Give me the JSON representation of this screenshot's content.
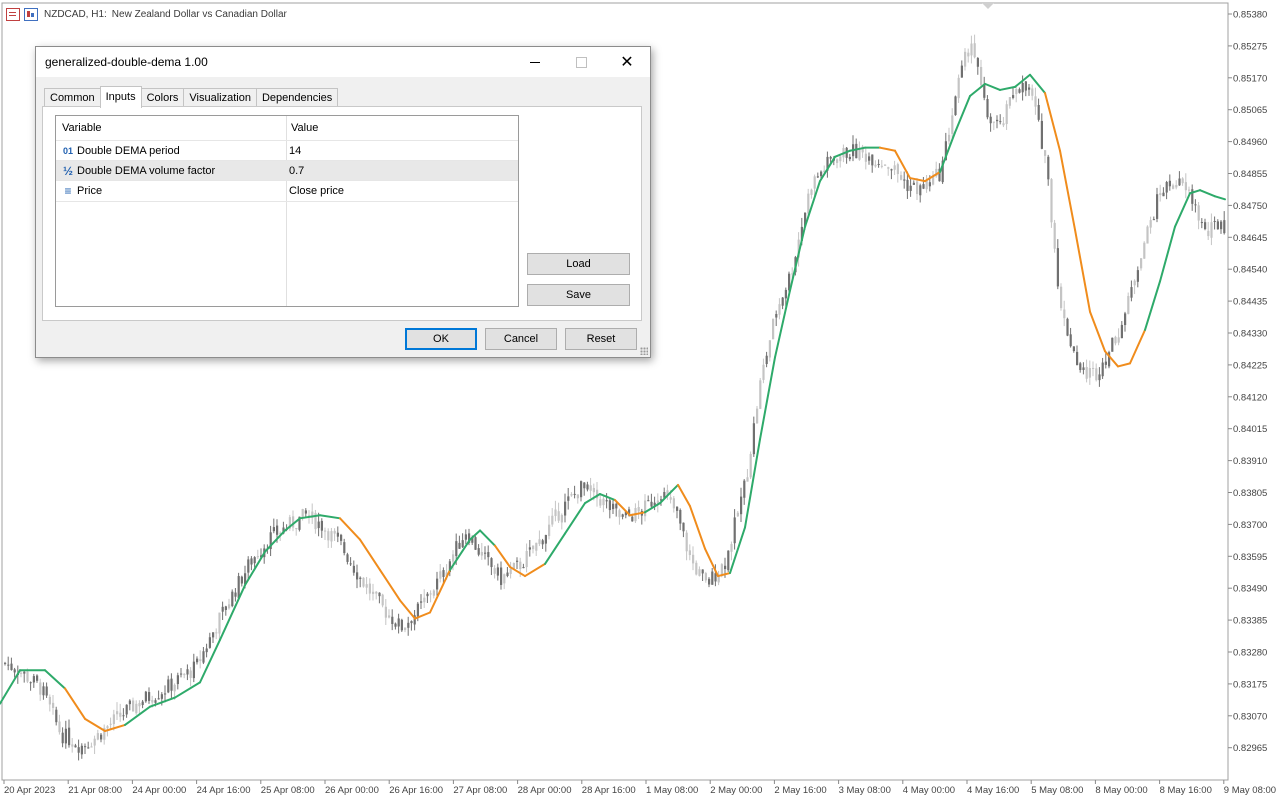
{
  "chart_header": {
    "symbol": "NZDCAD, H1:",
    "description": "New Zealand Dollar vs Canadian Dollar"
  },
  "colors": {
    "up_line": "#2eaa6a",
    "down_line": "#f08c1c",
    "candle_dark": "#707070",
    "candle_light": "#c4c4c4",
    "axis_text": "#444444"
  },
  "chart_data": {
    "type": "candlestick",
    "y_axis_labels": [
      "0.85380",
      "0.85275",
      "0.85170",
      "0.85065",
      "0.84960",
      "0.84855",
      "0.84750",
      "0.84645",
      "0.84540",
      "0.84435",
      "0.84330",
      "0.84225",
      "0.84120",
      "0.84015",
      "0.83910",
      "0.83805",
      "0.83700",
      "0.83595",
      "0.83490",
      "0.83385",
      "0.83280",
      "0.83175",
      "0.83070",
      "0.82965"
    ],
    "x_axis_labels": [
      "20 Apr 2023",
      "21 Apr 08:00",
      "24 Apr 00:00",
      "24 Apr 16:00",
      "25 Apr 08:00",
      "26 Apr 00:00",
      "26 Apr 16:00",
      "27 Apr 08:00",
      "28 Apr 00:00",
      "28 Apr 16:00",
      "1 May 08:00",
      "2 May 00:00",
      "2 May 16:00",
      "3 May 08:00",
      "4 May 00:00",
      "4 May 16:00",
      "5 May 08:00",
      "8 May 00:00",
      "8 May 16:00",
      "9 May 08:00"
    ],
    "ylim": [
      0.8291,
      0.8543
    ],
    "price_path": [
      [
        0,
        0.8325
      ],
      [
        18,
        0.8322
      ],
      [
        40,
        0.8316
      ],
      [
        60,
        0.8301
      ],
      [
        80,
        0.8297
      ],
      [
        95,
        0.83
      ],
      [
        115,
        0.8306
      ],
      [
        140,
        0.8312
      ],
      [
        165,
        0.8316
      ],
      [
        195,
        0.8323
      ],
      [
        220,
        0.834
      ],
      [
        250,
        0.8358
      ],
      [
        270,
        0.8366
      ],
      [
        290,
        0.837
      ],
      [
        305,
        0.8373
      ],
      [
        320,
        0.837
      ],
      [
        340,
        0.8363
      ],
      [
        360,
        0.8352
      ],
      [
        380,
        0.8343
      ],
      [
        400,
        0.8336
      ],
      [
        418,
        0.8342
      ],
      [
        440,
        0.8353
      ],
      [
        465,
        0.8368
      ],
      [
        480,
        0.836
      ],
      [
        500,
        0.8352
      ],
      [
        520,
        0.8357
      ],
      [
        540,
        0.8365
      ],
      [
        560,
        0.8375
      ],
      [
        580,
        0.8382
      ],
      [
        600,
        0.8378
      ],
      [
        620,
        0.8372
      ],
      [
        640,
        0.8374
      ],
      [
        660,
        0.8381
      ],
      [
        675,
        0.8374
      ],
      [
        690,
        0.8358
      ],
      [
        705,
        0.835
      ],
      [
        725,
        0.8358
      ],
      [
        745,
        0.8385
      ],
      [
        760,
        0.8418
      ],
      [
        775,
        0.844
      ],
      [
        790,
        0.8453
      ],
      [
        810,
        0.8482
      ],
      [
        830,
        0.849
      ],
      [
        850,
        0.8493
      ],
      [
        870,
        0.8491
      ],
      [
        890,
        0.8488
      ],
      [
        905,
        0.8482
      ],
      [
        920,
        0.848
      ],
      [
        940,
        0.8486
      ],
      [
        955,
        0.8512
      ],
      [
        970,
        0.853
      ],
      [
        985,
        0.8505
      ],
      [
        1000,
        0.85
      ],
      [
        1015,
        0.8515
      ],
      [
        1030,
        0.8512
      ],
      [
        1045,
        0.849
      ],
      [
        1060,
        0.844
      ],
      [
        1080,
        0.842
      ],
      [
        1095,
        0.842
      ],
      [
        1110,
        0.8428
      ],
      [
        1125,
        0.844
      ],
      [
        1140,
        0.846
      ],
      [
        1160,
        0.848
      ],
      [
        1175,
        0.8483
      ],
      [
        1190,
        0.8478
      ],
      [
        1205,
        0.8465
      ],
      [
        1220,
        0.847
      ],
      [
        1228,
        0.8466
      ]
    ],
    "dema_line": [
      [
        0,
        0.8311
      ],
      [
        20,
        0.8322
      ],
      [
        45,
        0.8322
      ],
      [
        65,
        0.8316
      ],
      [
        85,
        0.8306
      ],
      [
        105,
        0.8302
      ],
      [
        125,
        0.8304
      ],
      [
        150,
        0.831
      ],
      [
        175,
        0.8313
      ],
      [
        200,
        0.8318
      ],
      [
        220,
        0.8332
      ],
      [
        245,
        0.835
      ],
      [
        265,
        0.8361
      ],
      [
        285,
        0.8368
      ],
      [
        300,
        0.8372
      ],
      [
        320,
        0.8373
      ],
      [
        340,
        0.8372
      ],
      [
        360,
        0.8365
      ],
      [
        380,
        0.8355
      ],
      [
        400,
        0.8345
      ],
      [
        415,
        0.8339
      ],
      [
        430,
        0.8341
      ],
      [
        450,
        0.8355
      ],
      [
        470,
        0.8365
      ],
      [
        480,
        0.8368
      ],
      [
        495,
        0.8363
      ],
      [
        510,
        0.8356
      ],
      [
        525,
        0.8353
      ],
      [
        545,
        0.8357
      ],
      [
        565,
        0.8367
      ],
      [
        585,
        0.8377
      ],
      [
        600,
        0.838
      ],
      [
        615,
        0.8378
      ],
      [
        630,
        0.8373
      ],
      [
        645,
        0.8374
      ],
      [
        660,
        0.8377
      ],
      [
        672,
        0.8381
      ],
      [
        678,
        0.8383
      ],
      [
        690,
        0.8376
      ],
      [
        705,
        0.8362
      ],
      [
        718,
        0.8353
      ],
      [
        730,
        0.8354
      ],
      [
        745,
        0.8369
      ],
      [
        760,
        0.8398
      ],
      [
        775,
        0.8425
      ],
      [
        790,
        0.8447
      ],
      [
        805,
        0.8468
      ],
      [
        820,
        0.8483
      ],
      [
        835,
        0.8491
      ],
      [
        850,
        0.8493
      ],
      [
        865,
        0.8494
      ],
      [
        880,
        0.8494
      ],
      [
        895,
        0.8493
      ],
      [
        910,
        0.8484
      ],
      [
        925,
        0.8483
      ],
      [
        940,
        0.8486
      ],
      [
        955,
        0.8499
      ],
      [
        970,
        0.8511
      ],
      [
        985,
        0.8515
      ],
      [
        1000,
        0.8513
      ],
      [
        1015,
        0.8514
      ],
      [
        1030,
        0.8518
      ],
      [
        1045,
        0.8512
      ],
      [
        1060,
        0.8493
      ],
      [
        1075,
        0.8467
      ],
      [
        1090,
        0.844
      ],
      [
        1105,
        0.8427
      ],
      [
        1118,
        0.8422
      ],
      [
        1130,
        0.8423
      ],
      [
        1145,
        0.8434
      ],
      [
        1160,
        0.845
      ],
      [
        1175,
        0.8468
      ],
      [
        1190,
        0.8479
      ],
      [
        1200,
        0.848
      ],
      [
        1215,
        0.8478
      ],
      [
        1225,
        0.8477
      ]
    ],
    "dema_direction": [
      "up",
      "up",
      "up",
      "down",
      "down",
      "down",
      "up",
      "up",
      "up",
      "up",
      "up",
      "up",
      "up",
      "up",
      "up",
      "up",
      "down",
      "down",
      "down",
      "down",
      "down",
      "down",
      "up",
      "up",
      "up",
      "down",
      "down",
      "down",
      "up",
      "up",
      "up",
      "up",
      "down",
      "down",
      "up",
      "up",
      "up",
      "down",
      "down",
      "down",
      "down",
      "up",
      "up",
      "up",
      "up",
      "up",
      "up",
      "up",
      "up",
      "up",
      "up",
      "down",
      "down",
      "down",
      "down",
      "up",
      "up",
      "up",
      "up",
      "up",
      "up",
      "up",
      "down",
      "down",
      "down",
      "down",
      "down",
      "down",
      "down",
      "up",
      "up",
      "up",
      "up",
      "up",
      "up",
      "up",
      "down",
      "down"
    ]
  },
  "dialog": {
    "title": "generalized-double-dema 1.00",
    "tabs": [
      "Common",
      "Inputs",
      "Colors",
      "Visualization",
      "Dependencies"
    ],
    "active_tab": "Inputs",
    "grid_headers": {
      "variable": "Variable",
      "value": "Value"
    },
    "rows": [
      {
        "icon": "integer-icon",
        "icon_glyph": "01",
        "name": "Double DEMA period",
        "value": "14"
      },
      {
        "icon": "fraction-icon",
        "icon_glyph": "½",
        "name": "Double DEMA volume factor",
        "value": "0.7"
      },
      {
        "icon": "price-list-icon",
        "icon_glyph": "≡",
        "name": "Price",
        "value": "Close price"
      }
    ],
    "load_label": "Load",
    "save_label": "Save",
    "ok_label": "OK",
    "cancel_label": "Cancel",
    "reset_label": "Reset"
  }
}
